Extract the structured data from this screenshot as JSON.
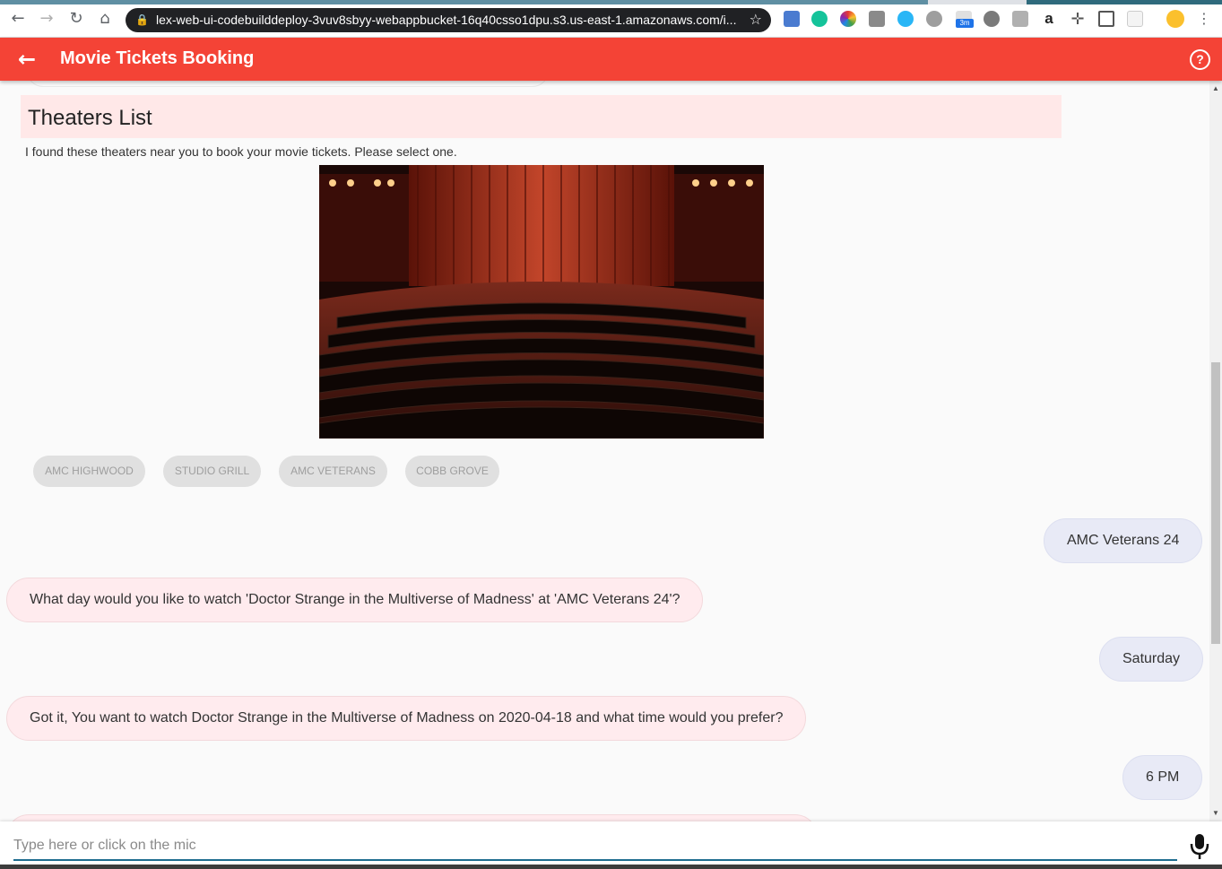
{
  "browser": {
    "url": "lex-web-ui-codebuilddeploy-3vuv8sbyy-webappbucket-16q40csso1dpu.s3.us-east-1.amazonaws.com/i...",
    "ext_badge": "3m",
    "ext_letter": "a"
  },
  "appbar": {
    "title": "Movie Tickets Booking",
    "color": "#f44336"
  },
  "card": {
    "title": "Theaters List",
    "subtitle": "I found these theaters near you to book your movie tickets. Please select one.",
    "image_icon": "theater-auditorium-image",
    "buttons": [
      "AMC HIGHWOOD",
      "STUDIO GRILL",
      "AMC VETERANS",
      "COBB GROVE"
    ]
  },
  "messages": [
    {
      "from": "user",
      "text": "AMC Veterans 24"
    },
    {
      "from": "bot",
      "text": "What day would you like to watch 'Doctor Strange in the Multiverse of Madness' at 'AMC Veterans 24'?"
    },
    {
      "from": "user",
      "text": "Saturday"
    },
    {
      "from": "bot",
      "text": "Got it, You want to watch Doctor Strange in the Multiverse of Madness on 2020-04-18 and what time would you prefer?"
    },
    {
      "from": "user",
      "text": "6 PM"
    }
  ],
  "input": {
    "placeholder": "Type here or click on the mic",
    "value": ""
  }
}
